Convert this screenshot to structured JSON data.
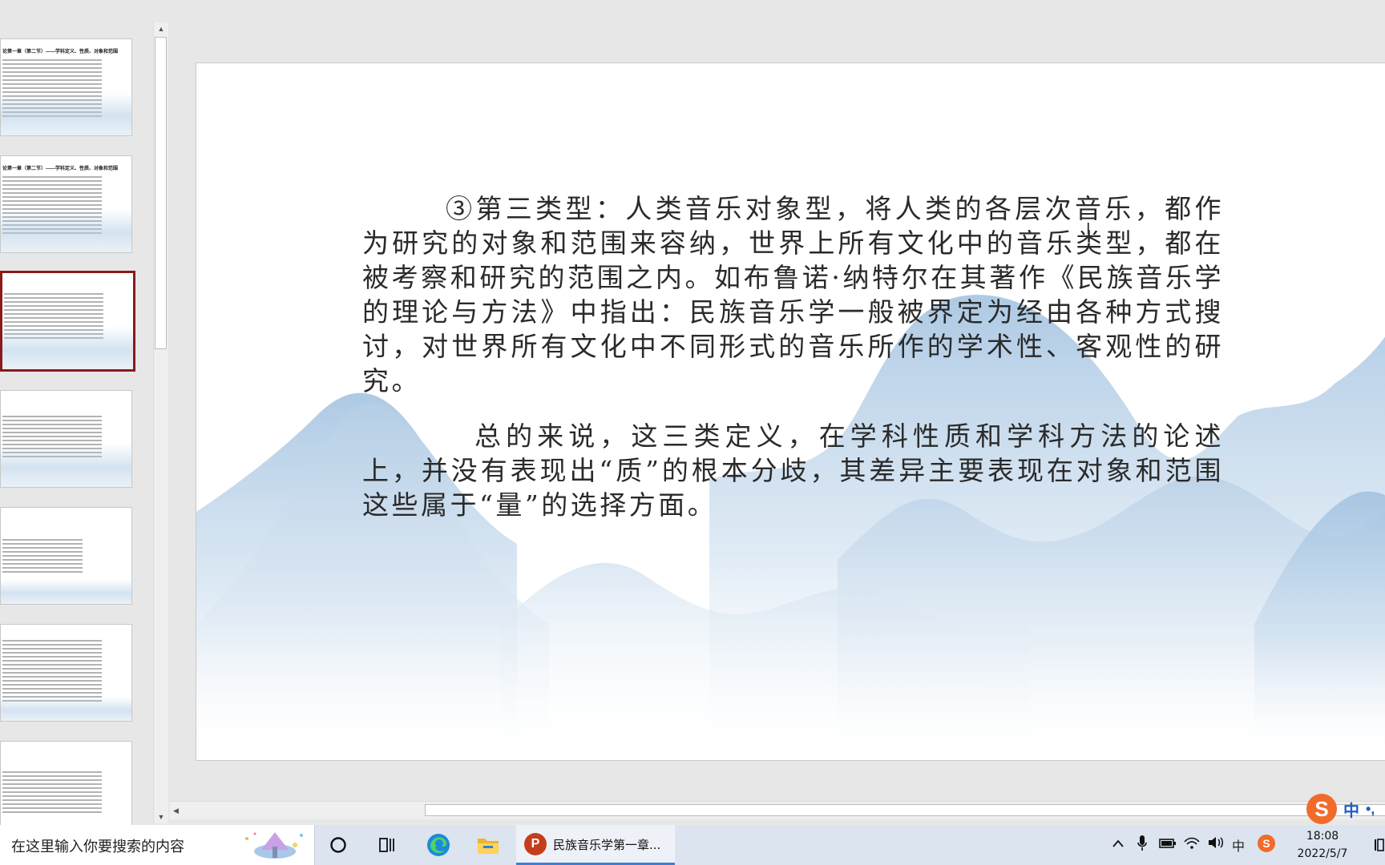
{
  "slide": {
    "paragraph1": "③第三类型：人类音乐对象型，将人类的各层次音乐，都作为研究的对象和范围来容纳，世界上所有文化中的音乐类型，都在被考察和研究的范围之内。如布鲁诺·纳特尔在其著作《民族音乐学的理论与方法》中指出：民族音乐学一般被界定为经由各种方式搜讨，对世界所有文化中不同形式的音乐所作的学术性、客观性的研究。",
    "paragraph2": "总的来说，这三类定义，在学科性质和学科方法的论述上，并没有表现出“质”的根本分歧，其差异主要表现在对象和范围这些属于“量”的选择方面。"
  },
  "thumbnails": {
    "thumb1_title": "论第一章（第二节）——学科定义、性质、对象和范围",
    "thumb2_title": "论第一章（第二节）——学科定义、性质、对象和范围",
    "selected_index": 3
  },
  "ime": {
    "logo": "S",
    "mode": "中",
    "punct": "•,"
  },
  "taskbar": {
    "search_placeholder": "在这里输入你要搜索的内容",
    "ppt_window_label": "民族音乐学第一章...",
    "ppt_badge": "P",
    "tray_ime": "中",
    "time": "18:08",
    "date": "2022/5/7"
  },
  "colors": {
    "selected_border": "#8b1a1a",
    "taskbar_bg": "#dce4ef",
    "ime_orange": "#f26b2a",
    "ppt_red": "#c43e1c"
  }
}
